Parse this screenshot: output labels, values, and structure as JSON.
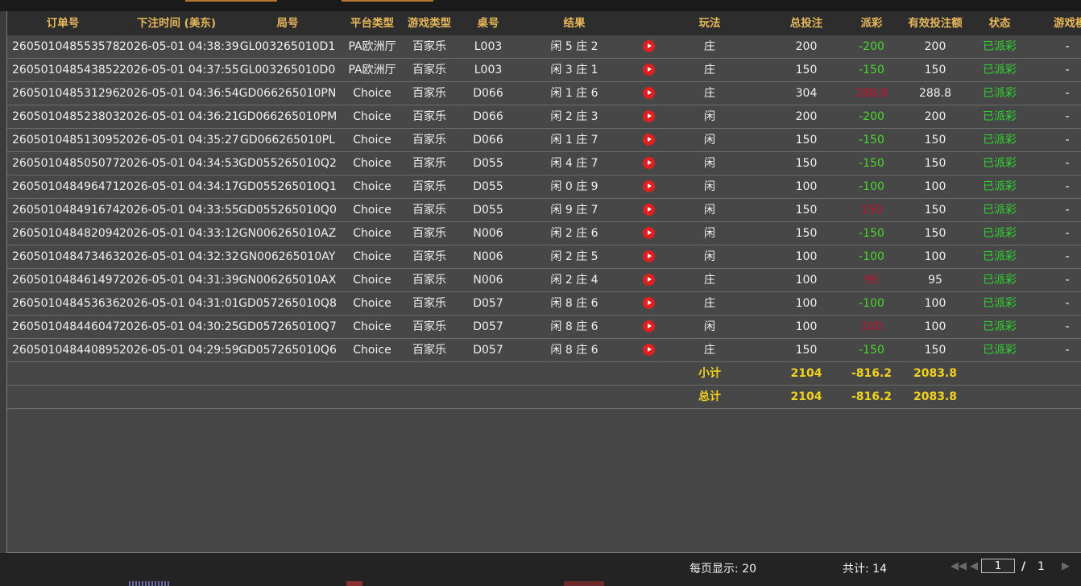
{
  "columns": [
    "订单号",
    "下注时间 (美东)",
    "局号",
    "平台类型",
    "游戏类型",
    "桌号",
    "结果",
    "玩法",
    "总投注",
    "派彩",
    "有效投注额",
    "状态",
    "游戏模式"
  ],
  "rows": [
    {
      "order": "260501048553578",
      "time": "2026-05-01 04:38:39",
      "round": "GL003265010D1",
      "platform": "PA欧洲厅",
      "game": "百家乐",
      "table": "L003",
      "result": "闲 5 庄 2",
      "play": "庄",
      "bet": "200",
      "payout": "-200",
      "payout_sign": "neg",
      "valid": "200",
      "status": "已派彩",
      "mode": "-"
    },
    {
      "order": "260501048543852",
      "time": "2026-05-01 04:37:55",
      "round": "GL003265010D0",
      "platform": "PA欧洲厅",
      "game": "百家乐",
      "table": "L003",
      "result": "闲 3 庄 1",
      "play": "庄",
      "bet": "150",
      "payout": "-150",
      "payout_sign": "neg",
      "valid": "150",
      "status": "已派彩",
      "mode": "-"
    },
    {
      "order": "260501048531296",
      "time": "2026-05-01 04:36:54",
      "round": "GD066265010PN",
      "platform": "Choice",
      "game": "百家乐",
      "table": "D066",
      "result": "闲 1 庄 6",
      "play": "庄",
      "bet": "304",
      "payout": "288.8",
      "payout_sign": "pos",
      "valid": "288.8",
      "status": "已派彩",
      "mode": "-"
    },
    {
      "order": "260501048523803",
      "time": "2026-05-01 04:36:21",
      "round": "GD066265010PM",
      "platform": "Choice",
      "game": "百家乐",
      "table": "D066",
      "result": "闲 2 庄 3",
      "play": "闲",
      "bet": "200",
      "payout": "-200",
      "payout_sign": "neg",
      "valid": "200",
      "status": "已派彩",
      "mode": "-"
    },
    {
      "order": "260501048513095",
      "time": "2026-05-01 04:35:27",
      "round": "GD066265010PL",
      "platform": "Choice",
      "game": "百家乐",
      "table": "D066",
      "result": "闲 1 庄 7",
      "play": "闲",
      "bet": "150",
      "payout": "-150",
      "payout_sign": "neg",
      "valid": "150",
      "status": "已派彩",
      "mode": "-"
    },
    {
      "order": "260501048505077",
      "time": "2026-05-01 04:34:53",
      "round": "GD055265010Q2",
      "platform": "Choice",
      "game": "百家乐",
      "table": "D055",
      "result": "闲 4 庄 7",
      "play": "闲",
      "bet": "150",
      "payout": "-150",
      "payout_sign": "neg",
      "valid": "150",
      "status": "已派彩",
      "mode": "-"
    },
    {
      "order": "260501048496471",
      "time": "2026-05-01 04:34:17",
      "round": "GD055265010Q1",
      "platform": "Choice",
      "game": "百家乐",
      "table": "D055",
      "result": "闲 0 庄 9",
      "play": "闲",
      "bet": "100",
      "payout": "-100",
      "payout_sign": "neg",
      "valid": "100",
      "status": "已派彩",
      "mode": "-"
    },
    {
      "order": "260501048491674",
      "time": "2026-05-01 04:33:55",
      "round": "GD055265010Q0",
      "platform": "Choice",
      "game": "百家乐",
      "table": "D055",
      "result": "闲 9 庄 7",
      "play": "闲",
      "bet": "150",
      "payout": "150",
      "payout_sign": "pos",
      "valid": "150",
      "status": "已派彩",
      "mode": "-"
    },
    {
      "order": "260501048482094",
      "time": "2026-05-01 04:33:12",
      "round": "GN006265010AZ",
      "platform": "Choice",
      "game": "百家乐",
      "table": "N006",
      "result": "闲 2 庄 6",
      "play": "闲",
      "bet": "150",
      "payout": "-150",
      "payout_sign": "neg",
      "valid": "150",
      "status": "已派彩",
      "mode": "-"
    },
    {
      "order": "260501048473463",
      "time": "2026-05-01 04:32:32",
      "round": "GN006265010AY",
      "platform": "Choice",
      "game": "百家乐",
      "table": "N006",
      "result": "闲 2 庄 5",
      "play": "闲",
      "bet": "100",
      "payout": "-100",
      "payout_sign": "neg",
      "valid": "100",
      "status": "已派彩",
      "mode": "-"
    },
    {
      "order": "260501048461497",
      "time": "2026-05-01 04:31:39",
      "round": "GN006265010AX",
      "platform": "Choice",
      "game": "百家乐",
      "table": "N006",
      "result": "闲 2 庄 4",
      "play": "庄",
      "bet": "100",
      "payout": "95",
      "payout_sign": "pos",
      "valid": "95",
      "status": "已派彩",
      "mode": "-"
    },
    {
      "order": "260501048453636",
      "time": "2026-05-01 04:31:01",
      "round": "GD057265010Q8",
      "platform": "Choice",
      "game": "百家乐",
      "table": "D057",
      "result": "闲 8 庄 6",
      "play": "庄",
      "bet": "100",
      "payout": "-100",
      "payout_sign": "neg",
      "valid": "100",
      "status": "已派彩",
      "mode": "-"
    },
    {
      "order": "260501048446047",
      "time": "2026-05-01 04:30:25",
      "round": "GD057265010Q7",
      "platform": "Choice",
      "game": "百家乐",
      "table": "D057",
      "result": "闲 8 庄 6",
      "play": "闲",
      "bet": "100",
      "payout": "100",
      "payout_sign": "pos",
      "valid": "100",
      "status": "已派彩",
      "mode": "-"
    },
    {
      "order": "260501048440895",
      "time": "2026-05-01 04:29:59",
      "round": "GD057265010Q6",
      "platform": "Choice",
      "game": "百家乐",
      "table": "D057",
      "result": "闲 8 庄 6",
      "play": "庄",
      "bet": "150",
      "payout": "-150",
      "payout_sign": "neg",
      "valid": "150",
      "status": "已派彩",
      "mode": "-"
    }
  ],
  "subtotal": {
    "label": "小计",
    "bet": "2104",
    "payout": "-816.2",
    "valid": "2083.8"
  },
  "total": {
    "label": "总计",
    "bet": "2104",
    "payout": "-816.2",
    "valid": "2083.8"
  },
  "footer": {
    "page_size_label": "每页显示: 20",
    "total_label": "共计: 14",
    "page_input": "1",
    "page_sep": "/",
    "page_count": "1"
  },
  "colors": {
    "header_text": "#e8b95a",
    "payout_negative": "#4bd62f",
    "payout_positive": "#c8102e",
    "status": "#2fd42f",
    "summary": "#f2d21e"
  }
}
